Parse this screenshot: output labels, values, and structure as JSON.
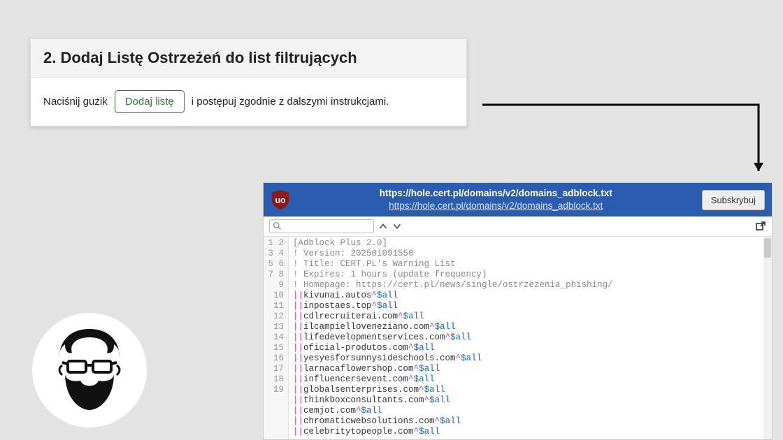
{
  "card": {
    "heading": "2. Dodaj Listę Ostrzeżeń do list filtrujących",
    "pre_text": "Naciśnij guzik",
    "button_label": "Dodaj listę",
    "post_text": "i postępuj zgodnie z dalszymi instrukcjami."
  },
  "panel": {
    "url_main": "https://hole.cert.pl/domains/v2/domains_adblock.txt",
    "url_sub": "https://hole.cert.pl/domains/v2/domains_adblock.txt",
    "subscribe_label": "Subskrybuj",
    "search_placeholder": ""
  },
  "code": {
    "comments": [
      "[Adblock Plus 2.0]",
      "! Version: 202501091550",
      "! Title: CERT.PL's Warning List",
      "! Expires: 1 hours (update frequency)",
      "! Homepage: https://cert.pl/news/single/ostrzezenia_phishing/"
    ],
    "rules": [
      "kivunai.autos",
      "inpostaes.top",
      "cdlrecruiterai.com",
      "ilcampielloveneziano.com",
      "lifedevelopmentservices.com",
      "oficial-produtos.com",
      "yesyesforsunnysideschools.com",
      "larnacaflowershop.com",
      "influencersevent.com",
      "globalsenterprises.com",
      "thinkboxconsultants.com",
      "cemjot.com",
      "chromaticwebsolutions.com",
      "celebritytopeople.com"
    ],
    "rule_prefix": "||",
    "rule_caret": "^",
    "rule_suffix": "$all"
  }
}
